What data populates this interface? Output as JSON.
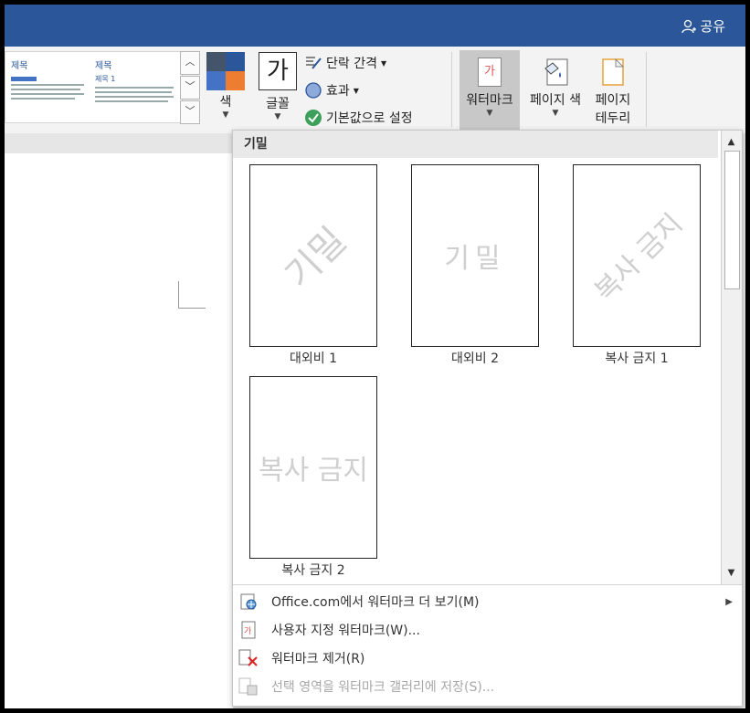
{
  "titlebar": {
    "share_label": "공유",
    "share_icon": "person-icon"
  },
  "themes": {
    "title1": "제목",
    "heading1": "제목 1",
    "title2": "제목",
    "heading2": "제목 1"
  },
  "ribbon": {
    "colors_label": "색",
    "fonts_label": "글꼴",
    "fonts_sample": "가",
    "paragraph_spacing_label": "단락 간격",
    "effects_label": "효과",
    "set_default_label": "기본값으로 설정",
    "watermark_label": "워터마크",
    "watermark_sample": "가",
    "page_color_label": "페이지 색",
    "page_borders_label1": "페이지",
    "page_borders_label2": "테두리"
  },
  "panel": {
    "section_title": "기밀",
    "items": [
      {
        "watermark_text": "기밀",
        "caption": "대외비 1"
      },
      {
        "watermark_text": "기밀",
        "caption": "대외비 2"
      },
      {
        "watermark_text": "복사 금지",
        "caption": "복사 금지 1"
      },
      {
        "watermark_text": "복사 금지",
        "caption": "복사 금지 2"
      }
    ],
    "menu": {
      "more": "Office.com에서 워터마크 더 보기(M)",
      "custom": "사용자 지정 워터마크(W)...",
      "remove": "워터마크 제거(R)",
      "save": "선택 영역을 워터마크 갤러리에 저장(S)..."
    }
  },
  "colors": {
    "titlebar": "#2b579a",
    "accent_orange": "#ed7d31",
    "accent_blue": "#4472c4"
  }
}
